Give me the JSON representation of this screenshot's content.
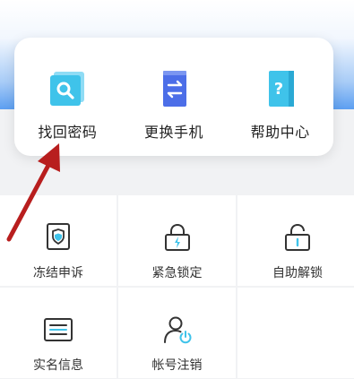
{
  "quick_actions": [
    {
      "label": "找回密码",
      "icon": "magnifier-card-icon"
    },
    {
      "label": "更换手机",
      "icon": "phone-swap-icon"
    },
    {
      "label": "帮助中心",
      "icon": "help-book-icon"
    }
  ],
  "services": [
    {
      "label": "冻结申诉",
      "icon": "shield-appeal-icon"
    },
    {
      "label": "紧急锁定",
      "icon": "lock-lightning-icon"
    },
    {
      "label": "自助解锁",
      "icon": "unlock-icon"
    },
    {
      "label": "实名信息",
      "icon": "id-card-icon"
    },
    {
      "label": "帐号注销",
      "icon": "user-power-icon"
    }
  ],
  "colors": {
    "accent_blue": "#5c9ff1",
    "icon_teal": "#3fc3ea",
    "icon_indigo": "#4c6ee8",
    "arrow_red": "#b81e1e"
  }
}
